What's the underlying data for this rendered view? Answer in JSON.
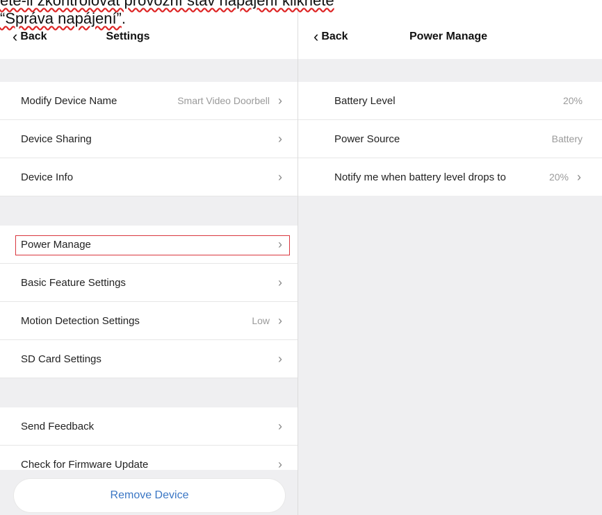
{
  "caption": {
    "line1": "ete-li zkontrolovat provozní stav napájení klikněte",
    "line2_quoted": "“Správa napájení”",
    "line2_tail": "."
  },
  "left": {
    "back_label": "Back",
    "title": "Settings",
    "section1": [
      {
        "label": "Modify Device Name",
        "value": "Smart  Video Doorbell",
        "chevron": "›"
      },
      {
        "label": "Device Sharing",
        "value": "",
        "chevron": "›"
      },
      {
        "label": "Device Info",
        "value": "",
        "chevron": "›"
      }
    ],
    "section2": [
      {
        "label": "Power Manage",
        "value": "",
        "chevron": "›"
      },
      {
        "label": "Basic Feature Settings",
        "value": "",
        "chevron": "›"
      },
      {
        "label": "Motion Detection Settings",
        "value": "Low",
        "chevron": "›"
      },
      {
        "label": "SD Card Settings",
        "value": "",
        "chevron": "›"
      }
    ],
    "section3": [
      {
        "label": "Send Feedback",
        "value": "",
        "chevron": "›"
      },
      {
        "label": "Check for Firmware Update",
        "value": "",
        "chevron": "›"
      }
    ],
    "remove_label": "Remove Device"
  },
  "right": {
    "back_label": "Back",
    "title": "Power Manage",
    "rows": [
      {
        "label": "Battery Level",
        "value": "20%"
      },
      {
        "label": "Power Source",
        "value": "Battery"
      },
      {
        "label": "Notify me when battery level drops to",
        "value": "20%",
        "chevron": "›"
      }
    ]
  },
  "colors": {
    "accent": "#3a76c4",
    "highlight": "#d9363e",
    "background": "#efeff1"
  }
}
